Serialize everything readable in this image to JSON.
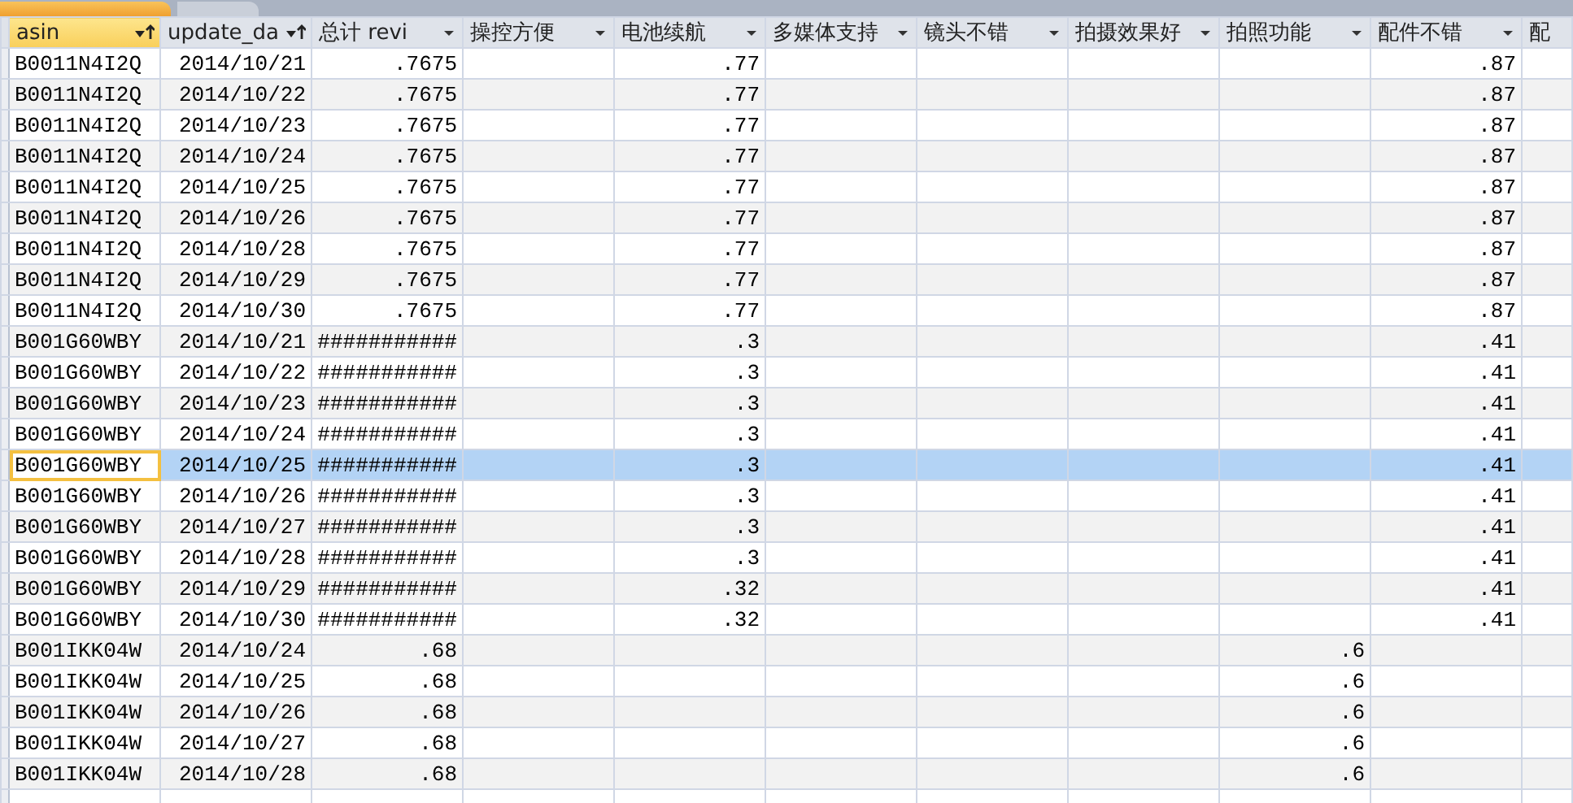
{
  "tabs": [
    {
      "selected": true
    },
    {
      "selected": false
    }
  ],
  "columns": [
    {
      "header": "asin",
      "sorted": true,
      "current": true
    },
    {
      "header": "update_da",
      "sorted": true,
      "current": false
    },
    {
      "header": "总计 revi",
      "sorted": false,
      "current": false
    },
    {
      "header": "操控方便",
      "sorted": false,
      "current": false
    },
    {
      "header": "电池续航",
      "sorted": false,
      "current": false
    },
    {
      "header": "多媒体支持",
      "sorted": false,
      "current": false
    },
    {
      "header": "镜头不错",
      "sorted": false,
      "current": false
    },
    {
      "header": "拍摄效果好",
      "sorted": false,
      "current": false
    },
    {
      "header": "拍照功能",
      "sorted": false,
      "current": false
    },
    {
      "header": "配件不错",
      "sorted": false,
      "current": false
    },
    {
      "header": "配",
      "current": false
    }
  ],
  "rows": [
    {
      "selected": false,
      "cells": [
        "B0011N4I2Q",
        "2014/10/21",
        ".7675",
        "",
        ".77",
        "",
        "",
        "",
        "",
        ".87",
        ""
      ]
    },
    {
      "selected": false,
      "cells": [
        "B0011N4I2Q",
        "2014/10/22",
        ".7675",
        "",
        ".77",
        "",
        "",
        "",
        "",
        ".87",
        ""
      ]
    },
    {
      "selected": false,
      "cells": [
        "B0011N4I2Q",
        "2014/10/23",
        ".7675",
        "",
        ".77",
        "",
        "",
        "",
        "",
        ".87",
        ""
      ]
    },
    {
      "selected": false,
      "cells": [
        "B0011N4I2Q",
        "2014/10/24",
        ".7675",
        "",
        ".77",
        "",
        "",
        "",
        "",
        ".87",
        ""
      ]
    },
    {
      "selected": false,
      "cells": [
        "B0011N4I2Q",
        "2014/10/25",
        ".7675",
        "",
        ".77",
        "",
        "",
        "",
        "",
        ".87",
        ""
      ]
    },
    {
      "selected": false,
      "cells": [
        "B0011N4I2Q",
        "2014/10/26",
        ".7675",
        "",
        ".77",
        "",
        "",
        "",
        "",
        ".87",
        ""
      ]
    },
    {
      "selected": false,
      "cells": [
        "B0011N4I2Q",
        "2014/10/28",
        ".7675",
        "",
        ".77",
        "",
        "",
        "",
        "",
        ".87",
        ""
      ]
    },
    {
      "selected": false,
      "cells": [
        "B0011N4I2Q",
        "2014/10/29",
        ".7675",
        "",
        ".77",
        "",
        "",
        "",
        "",
        ".87",
        ""
      ]
    },
    {
      "selected": false,
      "cells": [
        "B0011N4I2Q",
        "2014/10/30",
        ".7675",
        "",
        ".77",
        "",
        "",
        "",
        "",
        ".87",
        ""
      ]
    },
    {
      "selected": false,
      "cells": [
        "B001G60WBY",
        "2014/10/21",
        "###########",
        "",
        ".3",
        "",
        "",
        "",
        "",
        ".41",
        ""
      ]
    },
    {
      "selected": false,
      "cells": [
        "B001G60WBY",
        "2014/10/22",
        "###########",
        "",
        ".3",
        "",
        "",
        "",
        "",
        ".41",
        ""
      ]
    },
    {
      "selected": false,
      "cells": [
        "B001G60WBY",
        "2014/10/23",
        "###########",
        "",
        ".3",
        "",
        "",
        "",
        "",
        ".41",
        ""
      ]
    },
    {
      "selected": false,
      "cells": [
        "B001G60WBY",
        "2014/10/24",
        "###########",
        "",
        ".3",
        "",
        "",
        "",
        "",
        ".41",
        ""
      ]
    },
    {
      "selected": true,
      "cells": [
        "B001G60WBY",
        "2014/10/25",
        "###########",
        "",
        ".3",
        "",
        "",
        "",
        "",
        ".41",
        ""
      ]
    },
    {
      "selected": false,
      "cells": [
        "B001G60WBY",
        "2014/10/26",
        "###########",
        "",
        ".3",
        "",
        "",
        "",
        "",
        ".41",
        ""
      ]
    },
    {
      "selected": false,
      "cells": [
        "B001G60WBY",
        "2014/10/27",
        "###########",
        "",
        ".3",
        "",
        "",
        "",
        "",
        ".41",
        ""
      ]
    },
    {
      "selected": false,
      "cells": [
        "B001G60WBY",
        "2014/10/28",
        "###########",
        "",
        ".3",
        "",
        "",
        "",
        "",
        ".41",
        ""
      ]
    },
    {
      "selected": false,
      "cells": [
        "B001G60WBY",
        "2014/10/29",
        "###########",
        "",
        ".32",
        "",
        "",
        "",
        "",
        ".41",
        ""
      ]
    },
    {
      "selected": false,
      "cells": [
        "B001G60WBY",
        "2014/10/30",
        "###########",
        "",
        ".32",
        "",
        "",
        "",
        "",
        ".41",
        ""
      ]
    },
    {
      "selected": false,
      "cells": [
        "B001IKK04W",
        "2014/10/24",
        ".68",
        "",
        "",
        "",
        "",
        "",
        ".6",
        "",
        ""
      ]
    },
    {
      "selected": false,
      "cells": [
        "B001IKK04W",
        "2014/10/25",
        ".68",
        "",
        "",
        "",
        "",
        "",
        ".6",
        "",
        ""
      ]
    },
    {
      "selected": false,
      "cells": [
        "B001IKK04W",
        "2014/10/26",
        ".68",
        "",
        "",
        "",
        "",
        "",
        ".6",
        "",
        ""
      ]
    },
    {
      "selected": false,
      "cells": [
        "B001IKK04W",
        "2014/10/27",
        ".68",
        "",
        "",
        "",
        "",
        "",
        ".6",
        "",
        ""
      ]
    },
    {
      "selected": false,
      "cells": [
        "B001IKK04W",
        "2014/10/28",
        ".68",
        "",
        "",
        "",
        "",
        "",
        ".6",
        "",
        ""
      ]
    }
  ]
}
